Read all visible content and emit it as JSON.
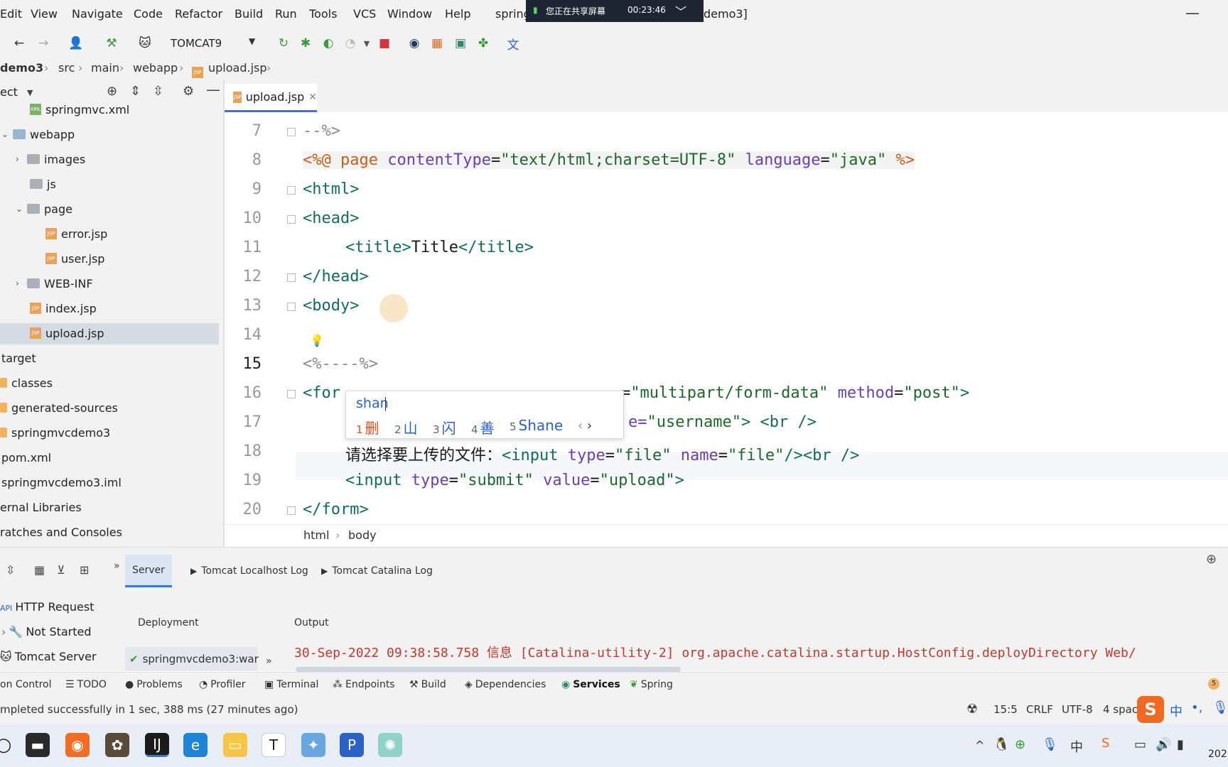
{
  "menu": {
    "items": [
      "Edit",
      "View",
      "Navigate",
      "Code",
      "Refactor",
      "Build",
      "Run",
      "Tools",
      "VCS",
      "Window",
      "Help"
    ],
    "title_left": "spring",
    "title_right": "demo3]"
  },
  "share_banner": {
    "text": "您正在共享屏幕",
    "timer": "00:23:46"
  },
  "toolbar": {
    "run_config": "TOMCAT9"
  },
  "breadcrumb": [
    "demo3",
    "src",
    "main",
    "webapp",
    "upload.jsp"
  ],
  "project": {
    "header": "ect",
    "items": [
      {
        "label": "springmvc.xml",
        "kind": "xml"
      },
      {
        "label": "webapp",
        "kind": "folder-open"
      },
      {
        "label": "images",
        "kind": "folder-closed"
      },
      {
        "label": "js",
        "kind": "folder"
      },
      {
        "label": "page",
        "kind": "folder-open"
      },
      {
        "label": "error.jsp",
        "kind": "jsp"
      },
      {
        "label": "user.jsp",
        "kind": "jsp"
      },
      {
        "label": "WEB-INF",
        "kind": "folder-closed"
      },
      {
        "label": "index.jsp",
        "kind": "jsp"
      },
      {
        "label": "upload.jsp",
        "kind": "jsp"
      },
      {
        "label": "target",
        "kind": "folder"
      },
      {
        "label": "classes",
        "kind": "folder"
      },
      {
        "label": "generated-sources",
        "kind": "folder"
      },
      {
        "label": "springmvcdemo3",
        "kind": "folder"
      },
      {
        "label": "pom.xml",
        "kind": "file"
      },
      {
        "label": "springmvcdemo3.iml",
        "kind": "file"
      },
      {
        "label": "ernal Libraries",
        "kind": "lib"
      },
      {
        "label": "ratches and Consoles",
        "kind": "lib"
      }
    ]
  },
  "editor": {
    "tab": "upload.jsp",
    "line_numbers": [
      "7",
      "8",
      "9",
      "10",
      "11",
      "12",
      "13",
      "14",
      "15",
      "16",
      "17",
      "18",
      "19",
      "20"
    ],
    "current_line": "15",
    "lines": {
      "l7": "--%>",
      "l8_open": "<%@",
      "l8_page": " page ",
      "l8_ct_attr": "contentType",
      "l8_ct_val": "\"text/html;charset=UTF-8\"",
      "l8_lang_attr": "language",
      "l8_lang_val": "\"java\"",
      "l8_close": "%>",
      "l9": "<html>",
      "l10": "<head>",
      "l11_open": "<title>",
      "l11_text": "Title",
      "l11_close": "</title>",
      "l12": "</head>",
      "l13": "<body>",
      "l15": "<%----%>",
      "l16_start": "<for",
      "l16_attr": "=",
      "l16_enc": "\"multipart/form-data\"",
      "l16_method": "method",
      "l16_post": "\"post\"",
      "l16_end": ">",
      "l17_tail": "e=",
      "l17_val": "\"username\"",
      "l17_br": "> <br />",
      "l18_text": "请选择要上传的文件：",
      "l18_input": "<input ",
      "l18_type": "type",
      "l18_file": "\"file\"",
      "l18_name": "name",
      "l18_fileval": "\"file\"",
      "l18_end": "/><br />",
      "l19_input": "<input ",
      "l19_type": "type",
      "l19_submit": "\"submit\"",
      "l19_value": "value",
      "l19_upload": "\"upload\"",
      "l19_end": ">",
      "l20": "</form>"
    },
    "crumbs": [
      "html",
      "body"
    ]
  },
  "ime": {
    "input": "shan",
    "candidates": [
      {
        "n": "1",
        "text": "删"
      },
      {
        "n": "2",
        "text": "山"
      },
      {
        "n": "3",
        "text": "闪"
      },
      {
        "n": "4",
        "text": "善"
      },
      {
        "n": "5",
        "text": "Shane"
      }
    ]
  },
  "services": {
    "tabs": [
      "Server",
      "Tomcat Localhost Log",
      "Tomcat Catalina Log"
    ],
    "tree": [
      "HTTP Request",
      "Not Started",
      "Tomcat Server"
    ],
    "deployment_label": "Deployment",
    "output_label": "Output",
    "deploy_item": "springmvcdemo3:war",
    "log_line": "30-Sep-2022 09:38:58.758 信息 [Catalina-utility-2] org.apache.catalina.startup.HostConfig.deployDirectory Web/"
  },
  "tool_windows": [
    "on Control",
    "TODO",
    "Problems",
    "Profiler",
    "Terminal",
    "Endpoints",
    "Build",
    "Dependencies",
    "Services",
    "Spring"
  ],
  "status": {
    "message": "mpleted successfully in 1 sec, 388 ms (27 minutes ago)",
    "position": "15:5",
    "line_sep": "CRLF",
    "encoding": "UTF-8",
    "indent": "4 spac",
    "ime_mode": "中",
    "year_frag": "202"
  }
}
